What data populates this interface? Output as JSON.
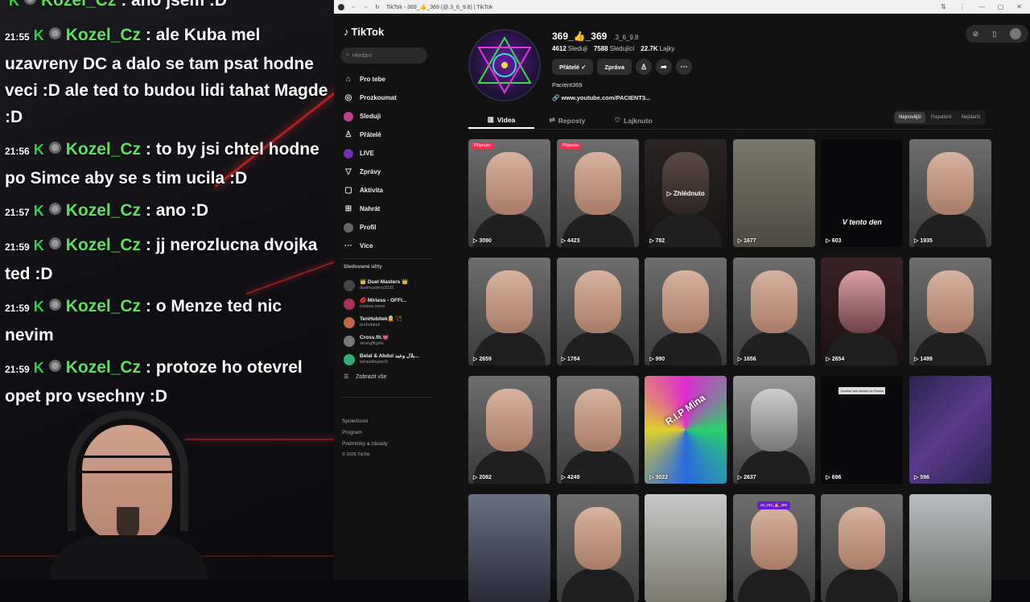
{
  "chat": [
    {
      "time": "",
      "user": "Kozel_Cz",
      "text": ": ano jsem :D"
    },
    {
      "time": "21:55",
      "user": "Kozel_Cz",
      "text": ": ale Kuba mel uzavreny DC a dalo se tam psat hodne veci :D ale ted to budou lidi tahat Magde :D"
    },
    {
      "time": "21:56",
      "user": "Kozel_Cz",
      "text": ": to by jsi chtel hodne po Simce aby se s tim ucila :D"
    },
    {
      "time": "21:57",
      "user": "Kozel_Cz",
      "text": ": ano :D"
    },
    {
      "time": "21:59",
      "user": "Kozel_Cz",
      "text": ": jj nerozlucna dvojka ted :D"
    },
    {
      "time": "21:59",
      "user": "Kozel_Cz",
      "text": ": o Menze ted nic nevim"
    },
    {
      "time": "21:59",
      "user": "Kozel_Cz",
      "text": ": protoze ho otevrel opet pro vsechny :D"
    }
  ],
  "browser": {
    "tab_title": "TikTok - 369_👍_369 (@.3_6_9.8) | TikTok"
  },
  "tiktok": {
    "logo": "TikTok",
    "search_placeholder": "Hledání",
    "nav": [
      {
        "label": "Pro tebe",
        "icon": "home-icon",
        "glyph": "⌂"
      },
      {
        "label": "Prozkoumat",
        "icon": "compass-icon",
        "glyph": "◎"
      },
      {
        "label": "Sleduji",
        "icon": "avatar-icon",
        "glyph": ""
      },
      {
        "label": "Přátelé",
        "icon": "friends-icon",
        "glyph": "♙"
      },
      {
        "label": "LIVE",
        "icon": "live-avatar-icon",
        "glyph": ""
      },
      {
        "label": "Zprávy",
        "icon": "messages-icon",
        "glyph": "▽"
      },
      {
        "label": "Aktivita",
        "icon": "activity-icon",
        "glyph": "▢"
      },
      {
        "label": "Nahrát",
        "icon": "upload-icon",
        "glyph": "⊞"
      },
      {
        "label": "Profil",
        "icon": "profile-icon",
        "glyph": ""
      },
      {
        "label": "Více",
        "icon": "more-icon",
        "glyph": "···"
      }
    ],
    "following_title": "Sledované účty",
    "following": [
      {
        "name": "👑 Duel Masters 👑",
        "user": "duelmasters2026"
      },
      {
        "name": "💋 Miriess - OFFI...",
        "user": "miriess.more"
      },
      {
        "name": "TenHobitek🧝 🏹",
        "user": "tenhobitek"
      },
      {
        "name": "Cross.fit.💓",
        "user": "strongfitgirls"
      },
      {
        "name": "Belal & Abdul بلال وعبد...",
        "user": "belalalfaweel3"
      }
    ],
    "show_all": "Zobrazit vše",
    "footer": [
      "Společnost",
      "Program",
      "Podmínky a zásady"
    ],
    "copyright": "© 2026 TikTok"
  },
  "profile": {
    "name": "369_👍_369",
    "handle": ".3_6_9.8",
    "following_count": "4612",
    "following_label": "Sleduji",
    "followers_count": "7588",
    "followers_label": "Sledující",
    "likes_count": "22.7K",
    "likes_label": "Lajky",
    "friends_btn": "Přátelé ✓",
    "message_btn": "Zpráva",
    "bio": "Pacient369",
    "link": "www.youtube.com/PACIENT3..."
  },
  "tabs": [
    {
      "label": "Videa",
      "icon": "grid-icon"
    },
    {
      "label": "Reposty",
      "icon": "repost-icon"
    },
    {
      "label": "Lajknuto",
      "icon": "heart-icon"
    }
  ],
  "sort": [
    "Nejnovější",
    "Populární",
    "Nejstarší"
  ],
  "videos": [
    {
      "views": "3090",
      "pinned": "Připnuto",
      "style": "face"
    },
    {
      "views": "4423",
      "pinned": "Připnuto",
      "style": "face"
    },
    {
      "views": "782",
      "overlay": "▷ Zhlédnuto",
      "style": "dark"
    },
    {
      "views": "1677",
      "style": "photo"
    },
    {
      "views": "603",
      "overlay2": "V tento den",
      "style": "black"
    },
    {
      "views": "1935",
      "style": "face"
    },
    {
      "views": "2659",
      "style": "face"
    },
    {
      "views": "1784",
      "style": "face"
    },
    {
      "views": "990",
      "style": "face"
    },
    {
      "views": "1656",
      "style": "face"
    },
    {
      "views": "2654",
      "style": "pink"
    },
    {
      "views": "1499",
      "style": "face"
    },
    {
      "views": "2082",
      "style": "face"
    },
    {
      "views": "4249",
      "style": "face"
    },
    {
      "views": "3022",
      "overlay4": "R.I.P Mina",
      "style": "neon"
    },
    {
      "views": "2637",
      "style": "gray"
    },
    {
      "views": "696",
      "overlay3": "Nuclear war started by Russia",
      "style": "black"
    },
    {
      "views": "596",
      "style": "fractal"
    },
    {
      "views": "",
      "style": "photo2"
    },
    {
      "views": "",
      "style": "face"
    },
    {
      "views": "",
      "style": "street"
    },
    {
      "views": "",
      "tag": "19_333_👍_369",
      "style": "face"
    },
    {
      "views": "",
      "style": "face"
    },
    {
      "views": "",
      "style": "river"
    }
  ]
}
